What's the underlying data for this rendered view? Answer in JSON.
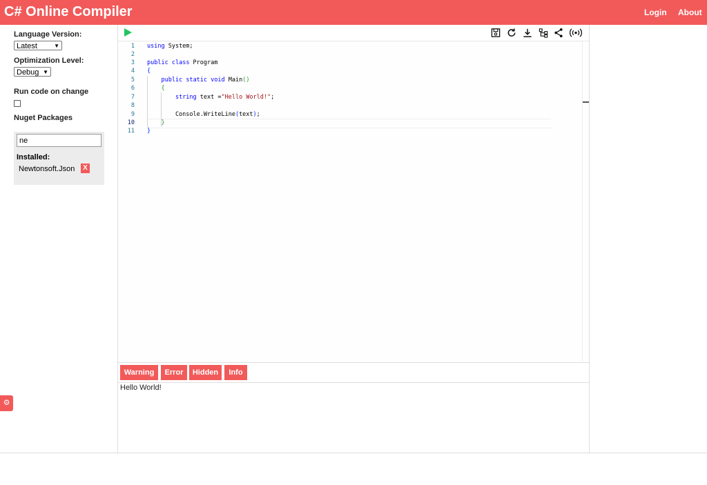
{
  "header": {
    "title": "C# Online Compiler",
    "nav": [
      "Login",
      "About"
    ],
    "accent_color": "#f25a5a"
  },
  "sidebar": {
    "language_version_label": "Language Version:",
    "language_version_value": "Latest",
    "optimization_label": "Optimization Level:",
    "optimization_value": "Debug",
    "run_on_change_label": "Run code on change",
    "run_on_change_checked": false,
    "nuget_label": "Nuget Packages",
    "nuget_search_value": "ne",
    "installed_label": "Installed:",
    "installed_packages": [
      {
        "name": "Newtonsoft.Json",
        "remove_label": "X"
      }
    ]
  },
  "toolbar": {
    "icons": [
      "run-icon",
      "save-icon",
      "refresh-icon",
      "download-icon",
      "fork-icon",
      "share-icon",
      "live-icon"
    ]
  },
  "editor": {
    "active_line": 10,
    "lines": [
      "using System;",
      "",
      "public class Program",
      "{",
      "    public static void Main()",
      "    {",
      "        string text =\"Hello World!\";",
      "",
      "        Console.WriteLine(text);",
      "    }",
      "}"
    ]
  },
  "output_tabs": [
    "Warning",
    "Error",
    "Hidden",
    "Info"
  ],
  "output_text": "Hello World!"
}
